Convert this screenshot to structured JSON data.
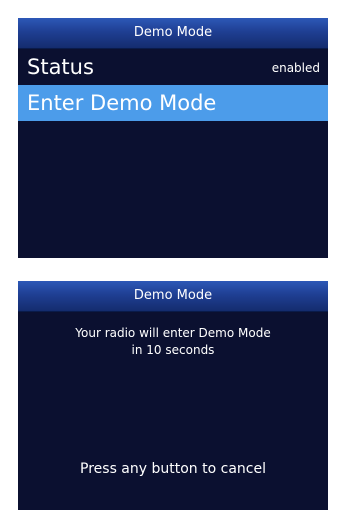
{
  "screens": [
    {
      "title": "Demo Mode",
      "menu": [
        {
          "label": "Status",
          "value": "enabled",
          "selected": false
        },
        {
          "label": "Enter Demo Mode",
          "selected": true
        }
      ]
    },
    {
      "title": "Demo Mode",
      "message_line1": "Your radio will enter Demo Mode",
      "message_line2": "in 10 seconds",
      "hint": "Press any button to cancel"
    }
  ],
  "colors": {
    "screen_background": "#0b1030",
    "title_bar": "#1f3f93",
    "selection_highlight": "#4c9cea",
    "text": "#ffffff"
  }
}
